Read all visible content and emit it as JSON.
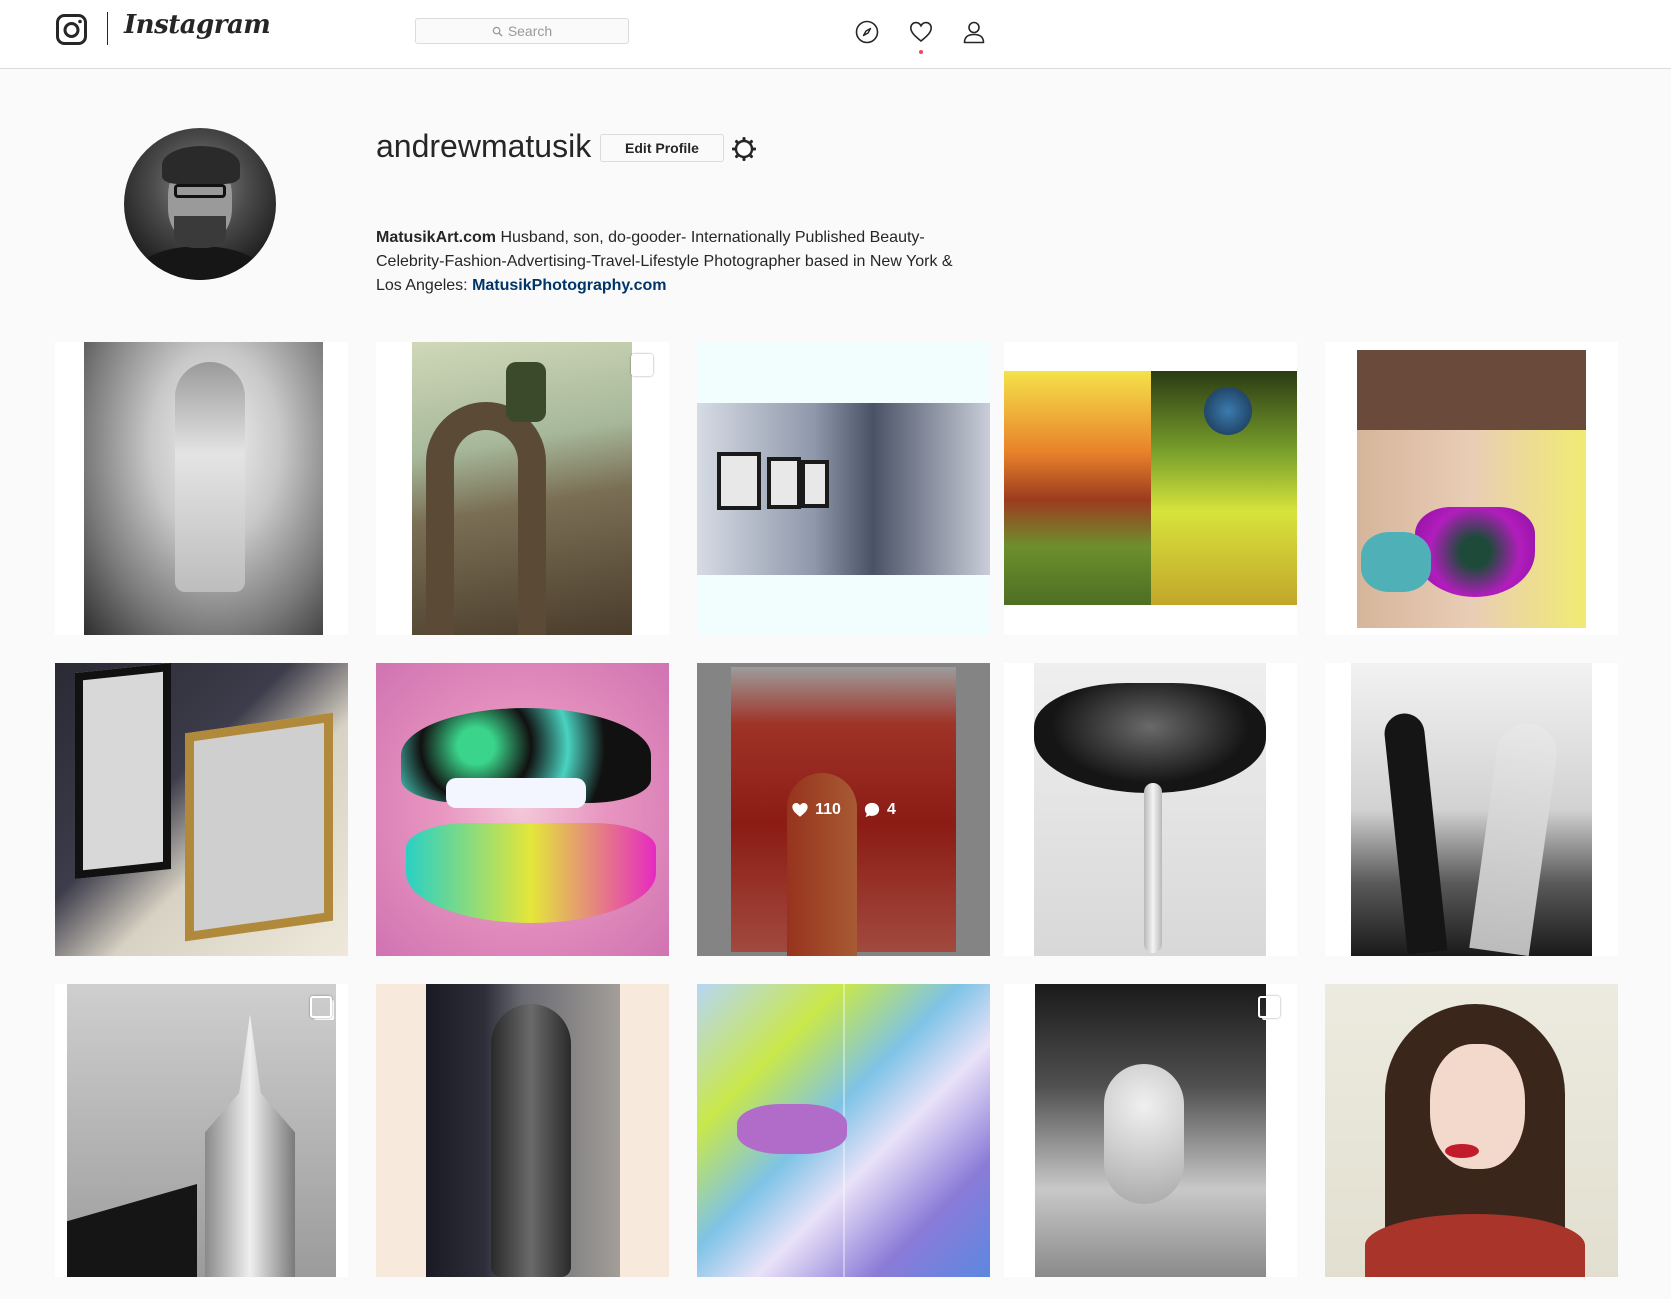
{
  "header": {
    "logo_text": "Instagram",
    "search_placeholder": "Search",
    "nav_icons": [
      "compass-icon",
      "heart-icon",
      "person-icon"
    ],
    "notification_dot_color": "#ed4956"
  },
  "profile": {
    "username": "andrewmatusik",
    "edit_button_label": "Edit Profile",
    "bio_name": "MatusikArt.com",
    "bio_text": " Husband, son, do-gooder- Internationally Published Beauty-Celebrity-Fashion-Advertising-Travel-Lifestyle Photographer based in New York & Los Angeles: ",
    "bio_link": "MatusikPhotography.com"
  },
  "posts": [
    {
      "subject": "bw-couple-photo",
      "multiple": false
    },
    {
      "subject": "arch-statue-photo",
      "multiple": true
    },
    {
      "subject": "gallery-interior-photo",
      "multiple": false
    },
    {
      "subject": "surreal-diptych-photo",
      "multiple": false
    },
    {
      "subject": "beauty-collage-photo",
      "multiple": false
    },
    {
      "subject": "framed-prints-photo",
      "multiple": false
    },
    {
      "subject": "feather-lips-photo",
      "multiple": false
    },
    {
      "subject": "red-lipstick-photo",
      "multiple": false,
      "likes": "110",
      "comments": "4"
    },
    {
      "subject": "dripping-lips-photo",
      "multiple": false
    },
    {
      "subject": "bw-wedding-photo",
      "multiple": false
    },
    {
      "subject": "chrysler-building-photo",
      "multiple": true
    },
    {
      "subject": "statue-window-photo",
      "multiple": false
    },
    {
      "subject": "color-abstract-photo",
      "multiple": false
    },
    {
      "subject": "bw-bed-portrait-photo",
      "multiple": true
    },
    {
      "subject": "woman-portrait-photo",
      "multiple": false
    }
  ]
}
